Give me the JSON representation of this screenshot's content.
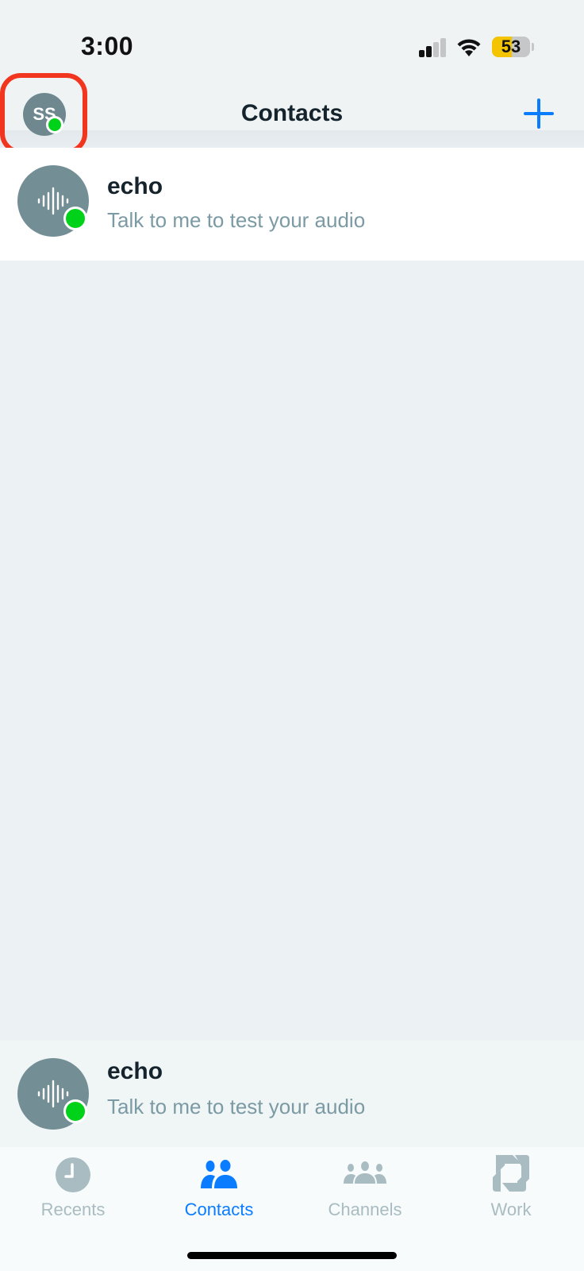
{
  "status_bar": {
    "time": "3:00",
    "battery_level": "53",
    "battery_percent": 53,
    "signal_bars_active": 2,
    "signal_bars_total": 4
  },
  "header": {
    "title": "Contacts",
    "self_avatar_initials": "SS",
    "self_presence": "online",
    "add_icon": "plus-icon"
  },
  "contacts": [
    {
      "name": "echo",
      "status": "Talk to me to test your audio",
      "avatar_icon": "audio-waveform-icon",
      "presence": "online"
    }
  ],
  "mini_player": {
    "name": "echo",
    "status": "Talk to me to test your audio",
    "avatar_icon": "audio-waveform-icon",
    "presence": "online"
  },
  "tabs": [
    {
      "label": "Recents",
      "icon": "clock-icon",
      "active": false
    },
    {
      "label": "Contacts",
      "icon": "contacts-icon",
      "active": true
    },
    {
      "label": "Channels",
      "icon": "channels-icon",
      "active": false
    },
    {
      "label": "Work",
      "icon": "work-icon",
      "active": false
    }
  ],
  "colors": {
    "accent": "#0a7cff",
    "presence_online": "#00d21a",
    "highlight_outline": "#f2351f",
    "inactive_tab": "#a8bcc1",
    "battery_fill": "#f5c400"
  }
}
